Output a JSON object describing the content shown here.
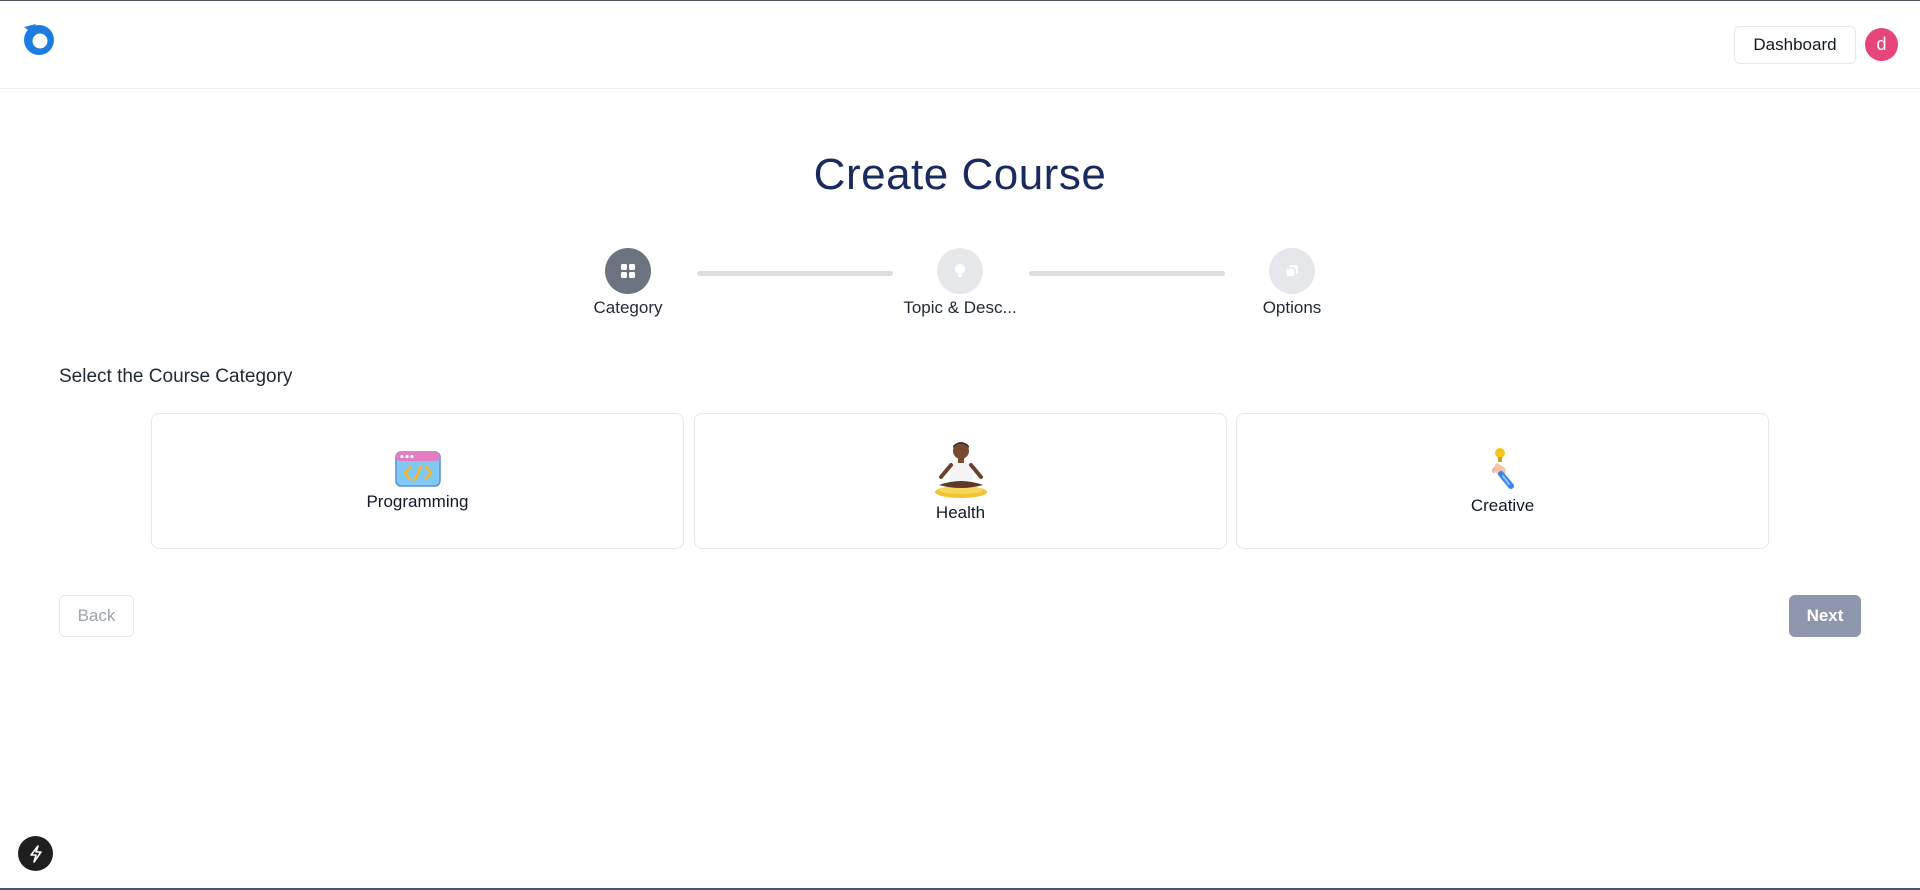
{
  "header": {
    "dashboard_label": "Dashboard",
    "avatar_initial": "d",
    "avatar_color": "#e6457a",
    "brand_color": "#1e7be0"
  },
  "page": {
    "title": "Create Course"
  },
  "stepper": {
    "steps": [
      {
        "label": "Category",
        "icon": "grid-icon",
        "active": true
      },
      {
        "label": "Topic & Desc...",
        "icon": "lightbulb-icon",
        "active": false
      },
      {
        "label": "Options",
        "icon": "copy-icon",
        "active": false
      }
    ]
  },
  "category_section": {
    "label": "Select the Course Category",
    "cards": [
      {
        "label": "Programming",
        "icon": "code-window-icon"
      },
      {
        "label": "Health",
        "icon": "meditation-person-icon"
      },
      {
        "label": "Creative",
        "icon": "hand-lightbulb-icon"
      }
    ]
  },
  "actions": {
    "back_label": "Back",
    "next_label": "Next"
  }
}
